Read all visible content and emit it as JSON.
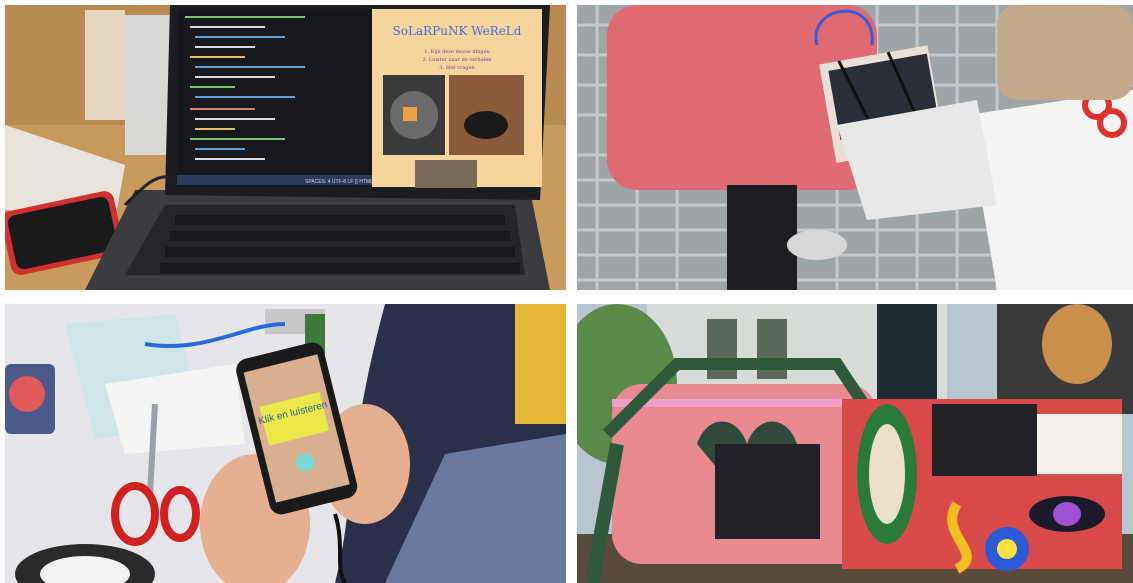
{
  "photos": [
    {
      "laptop_site": {
        "title": "SoLaRPuNK WeReLd",
        "bullets": [
          "1. Kijk deze mooie dingen",
          "2. Luister naar de verhalen",
          "3. Stel vragen"
        ]
      },
      "code_status": "SPACES: 4   UTF-8   LF   {} HTML"
    },
    {},
    {
      "phone_button": "Klik en luisteren"
    },
    {}
  ],
  "colors": {
    "page_bg": "#ffffff",
    "sweater": "#e06a72",
    "phone_screen": "#ece84a",
    "fluffy_bag": "#e88a90",
    "painted_box": "#d84a4a"
  }
}
